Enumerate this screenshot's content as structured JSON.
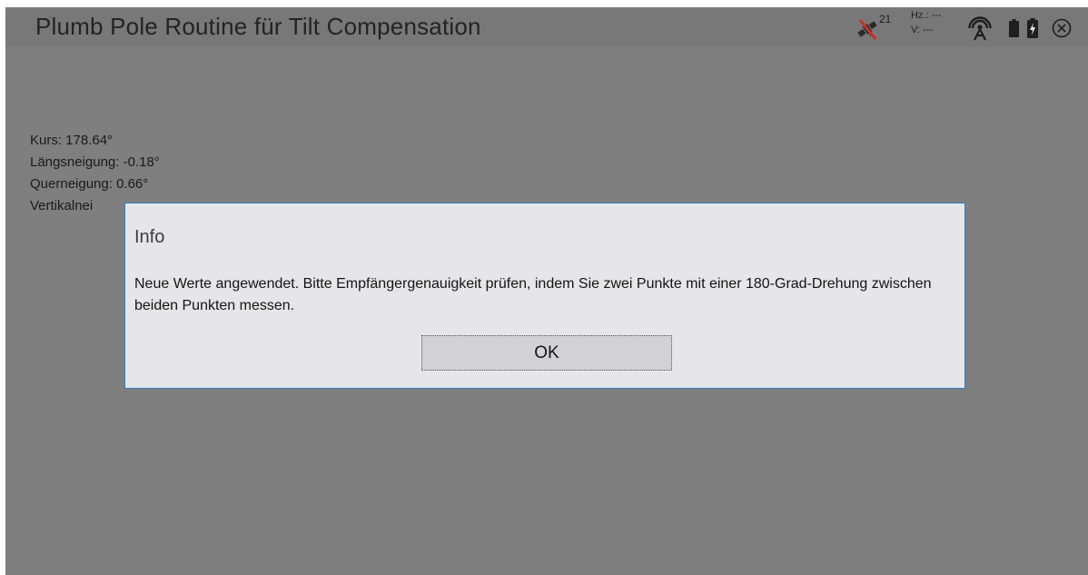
{
  "app": {
    "title": "Plumb Pole Routine für Tilt Compensation"
  },
  "status": {
    "satellite_count": "21",
    "hz_label": "Hz.: ---",
    "v_label": "V: ---",
    "icons": {
      "satellite": "satellite-no-fix-icon",
      "radio": "radio-signal-icon",
      "battery": "battery-icon",
      "charging": "battery-charging-icon",
      "close": "close-circle-icon"
    },
    "accent_color": "#c9302c"
  },
  "readings": {
    "kurs": "Kurs: 178.64°",
    "laengsneigung": "Längsneigung: -0.18°",
    "querneigung": "Querneigung: 0.66°",
    "vertikalneigung": "Vertikalnei"
  },
  "dialog": {
    "title": "Info",
    "message": "Neue Werte angewendet. Bitte Empfängergenauigkeit prüfen, indem Sie zwei Punkte mit einer 180-Grad-Drehung zwischen beiden Punkten messen.",
    "ok_label": "OK",
    "border_color": "#2e7bc4"
  }
}
